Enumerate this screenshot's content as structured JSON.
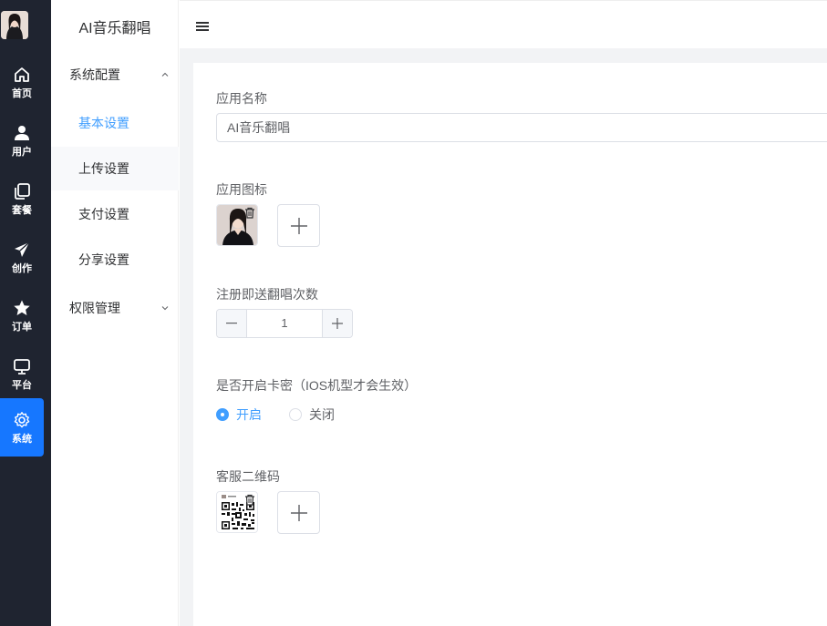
{
  "rail": {
    "items": [
      {
        "label": "首页",
        "icon": "home-icon"
      },
      {
        "label": "用户",
        "icon": "user-icon"
      },
      {
        "label": "套餐",
        "icon": "copy-icon"
      },
      {
        "label": "创作",
        "icon": "send-icon"
      },
      {
        "label": "订单",
        "icon": "star-icon"
      },
      {
        "label": "平台",
        "icon": "monitor-icon"
      },
      {
        "label": "系统",
        "icon": "gear-icon"
      }
    ],
    "active_color": "#1677ff"
  },
  "submenu": {
    "app_title": "AI音乐翻唱",
    "group_system": "系统配置",
    "items": [
      "基本设置",
      "上传设置",
      "支付设置",
      "分享设置"
    ],
    "group_permission": "权限管理",
    "active_color": "#409eff"
  },
  "form": {
    "app_name_label": "应用名称",
    "app_name_value": "AI音乐翻唱",
    "app_icon_label": "应用图标",
    "register_label": "注册即送翻唱次数",
    "register_value": "1",
    "card_label": "是否开启卡密（IOS机型才会生效）",
    "radio_on": "开启",
    "radio_off": "关闭",
    "qr_label": "客服二维码"
  }
}
